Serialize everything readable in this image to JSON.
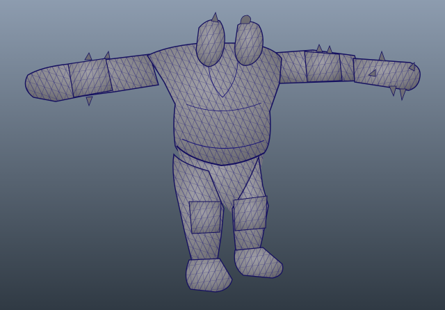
{
  "viewport": {
    "bg_top": "#8d9caf",
    "bg_bottom": "#303a44",
    "mesh_fill": "#85848a",
    "mesh_shade": "#5e5d63",
    "wire_color": "#1f1a78",
    "outline_color": "#151060"
  },
  "model": {
    "icon": "ogre-character-mesh-icon",
    "pose": "t-pose",
    "heads": 2
  }
}
